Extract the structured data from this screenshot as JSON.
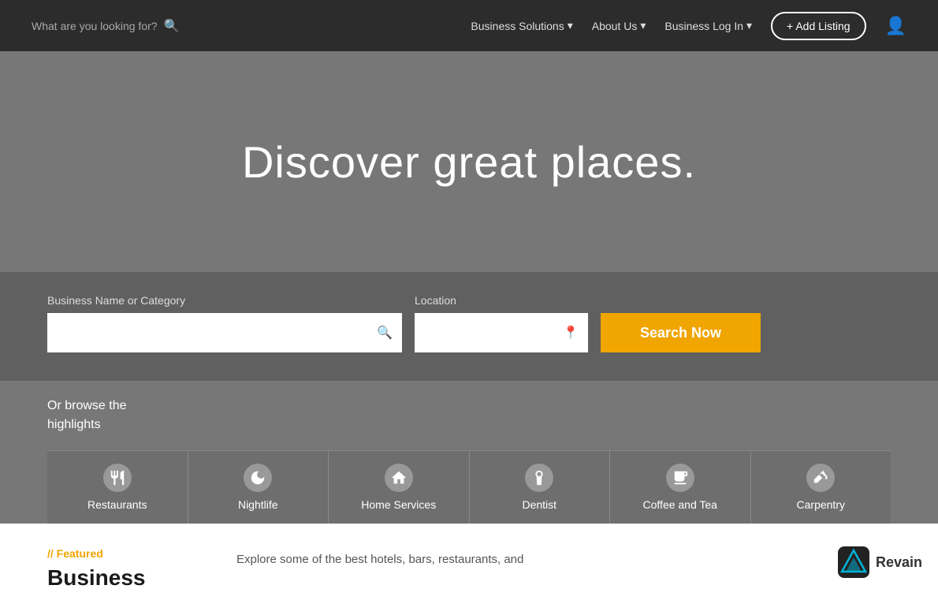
{
  "navbar": {
    "search_placeholder": "What are you looking for?",
    "links": [
      {
        "label": "Business Solutions",
        "has_dropdown": true
      },
      {
        "label": "About Us",
        "has_dropdown": true
      },
      {
        "label": "Business Log In",
        "has_dropdown": true
      }
    ],
    "add_listing_label": "+ Add Listing",
    "user_icon_label": "user"
  },
  "hero": {
    "title": "Discover great places."
  },
  "search": {
    "business_label": "Business Name or Category",
    "business_placeholder": "",
    "location_label": "Location",
    "location_placeholder": "",
    "button_label": "Search Now"
  },
  "browse": {
    "text_line1": "Or browse the",
    "text_line2": "highlights"
  },
  "categories": [
    {
      "label": "Restaurants",
      "icon": "fork-knife"
    },
    {
      "label": "Nightlife",
      "icon": "moon"
    },
    {
      "label": "Home Services",
      "icon": "home"
    },
    {
      "label": "Dentist",
      "icon": "tooth"
    },
    {
      "label": "Coffee and Tea",
      "icon": "coffee"
    },
    {
      "label": "Carpentry",
      "icon": "hammer"
    }
  ],
  "featured": {
    "tag": "// Featured",
    "heading": "Business",
    "description": "Explore some of the best hotels, bars, restaurants, and"
  },
  "revain": {
    "text": "Revain"
  }
}
